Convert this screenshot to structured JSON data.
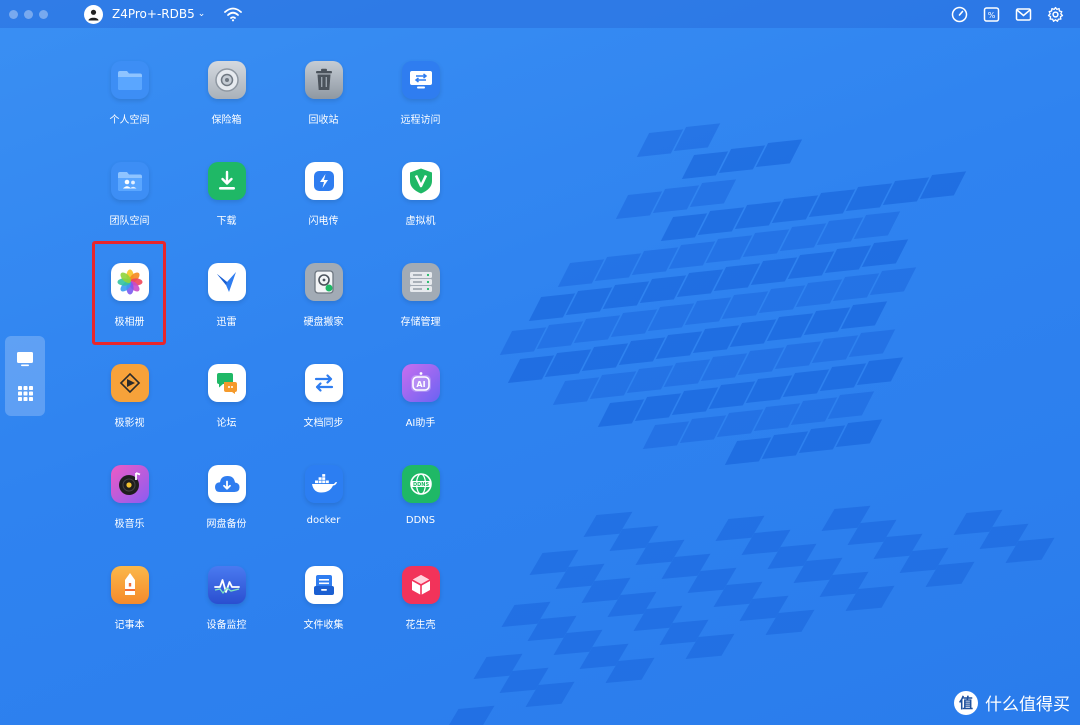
{
  "topbar": {
    "device_name": "Z4Pro+-RDB5",
    "icons": [
      "user-avatar-icon",
      "wifi-icon",
      "speed-gauge-icon",
      "percent-badge-icon",
      "mail-icon",
      "settings-gear-icon"
    ]
  },
  "dock": {
    "items": [
      "desktop-icon",
      "app-grid-icon"
    ]
  },
  "apps": [
    {
      "label": "个人空间",
      "icon": "folder-icon",
      "color": "#3d8ef5"
    },
    {
      "label": "保险箱",
      "icon": "safe-icon",
      "color": "#b9c0c9"
    },
    {
      "label": "回收站",
      "icon": "trash-icon",
      "color": "#9aa3ad"
    },
    {
      "label": "远程访问",
      "icon": "remote-access-icon",
      "color": "#2f7df0"
    },
    {
      "label": "团队空间",
      "icon": "team-folder-icon",
      "color": "#3d8ef5"
    },
    {
      "label": "下载",
      "icon": "download-icon",
      "color": "#1fb866"
    },
    {
      "label": "闪电传",
      "icon": "lightning-transfer-icon",
      "color": "#ffffff"
    },
    {
      "label": "虚拟机",
      "icon": "virtual-machine-icon",
      "color": "#ffffff"
    },
    {
      "label": "极相册",
      "icon": "photos-flower-icon",
      "color": "#ffffff"
    },
    {
      "label": "迅雷",
      "icon": "xunlei-bird-icon",
      "color": "#ffffff"
    },
    {
      "label": "硬盘搬家",
      "icon": "disk-move-icon",
      "color": "#a2abb5"
    },
    {
      "label": "存储管理",
      "icon": "storage-manager-icon",
      "color": "#a2abb5"
    },
    {
      "label": "极影视",
      "icon": "video-icon",
      "color": "#f7a23a"
    },
    {
      "label": "论坛",
      "icon": "forum-chat-icon",
      "color": "#ffffff"
    },
    {
      "label": "文档同步",
      "icon": "sync-arrows-icon",
      "color": "#ffffff"
    },
    {
      "label": "AI助手",
      "icon": "ai-assistant-icon",
      "color": "#a36bf2"
    },
    {
      "label": "极音乐",
      "icon": "music-disc-icon",
      "color": "#a35df0"
    },
    {
      "label": "网盘备份",
      "icon": "cloud-backup-icon",
      "color": "#ffffff"
    },
    {
      "label": "docker",
      "icon": "docker-whale-icon",
      "color": "#2c7ef2"
    },
    {
      "label": "DDNS",
      "icon": "ddns-globe-icon",
      "color": "#1fb866"
    },
    {
      "label": "记事本",
      "icon": "notepad-pencil-icon",
      "color": "#f9a43c"
    },
    {
      "label": "设备监控",
      "icon": "device-monitor-icon",
      "color": "#3366e6"
    },
    {
      "label": "文件收集",
      "icon": "file-collect-icon",
      "color": "#ffffff"
    },
    {
      "label": "花生壳",
      "icon": "peanut-cube-icon",
      "color": "#f2335a"
    }
  ],
  "watermark": {
    "badge": "值",
    "text": "什么值得买"
  }
}
